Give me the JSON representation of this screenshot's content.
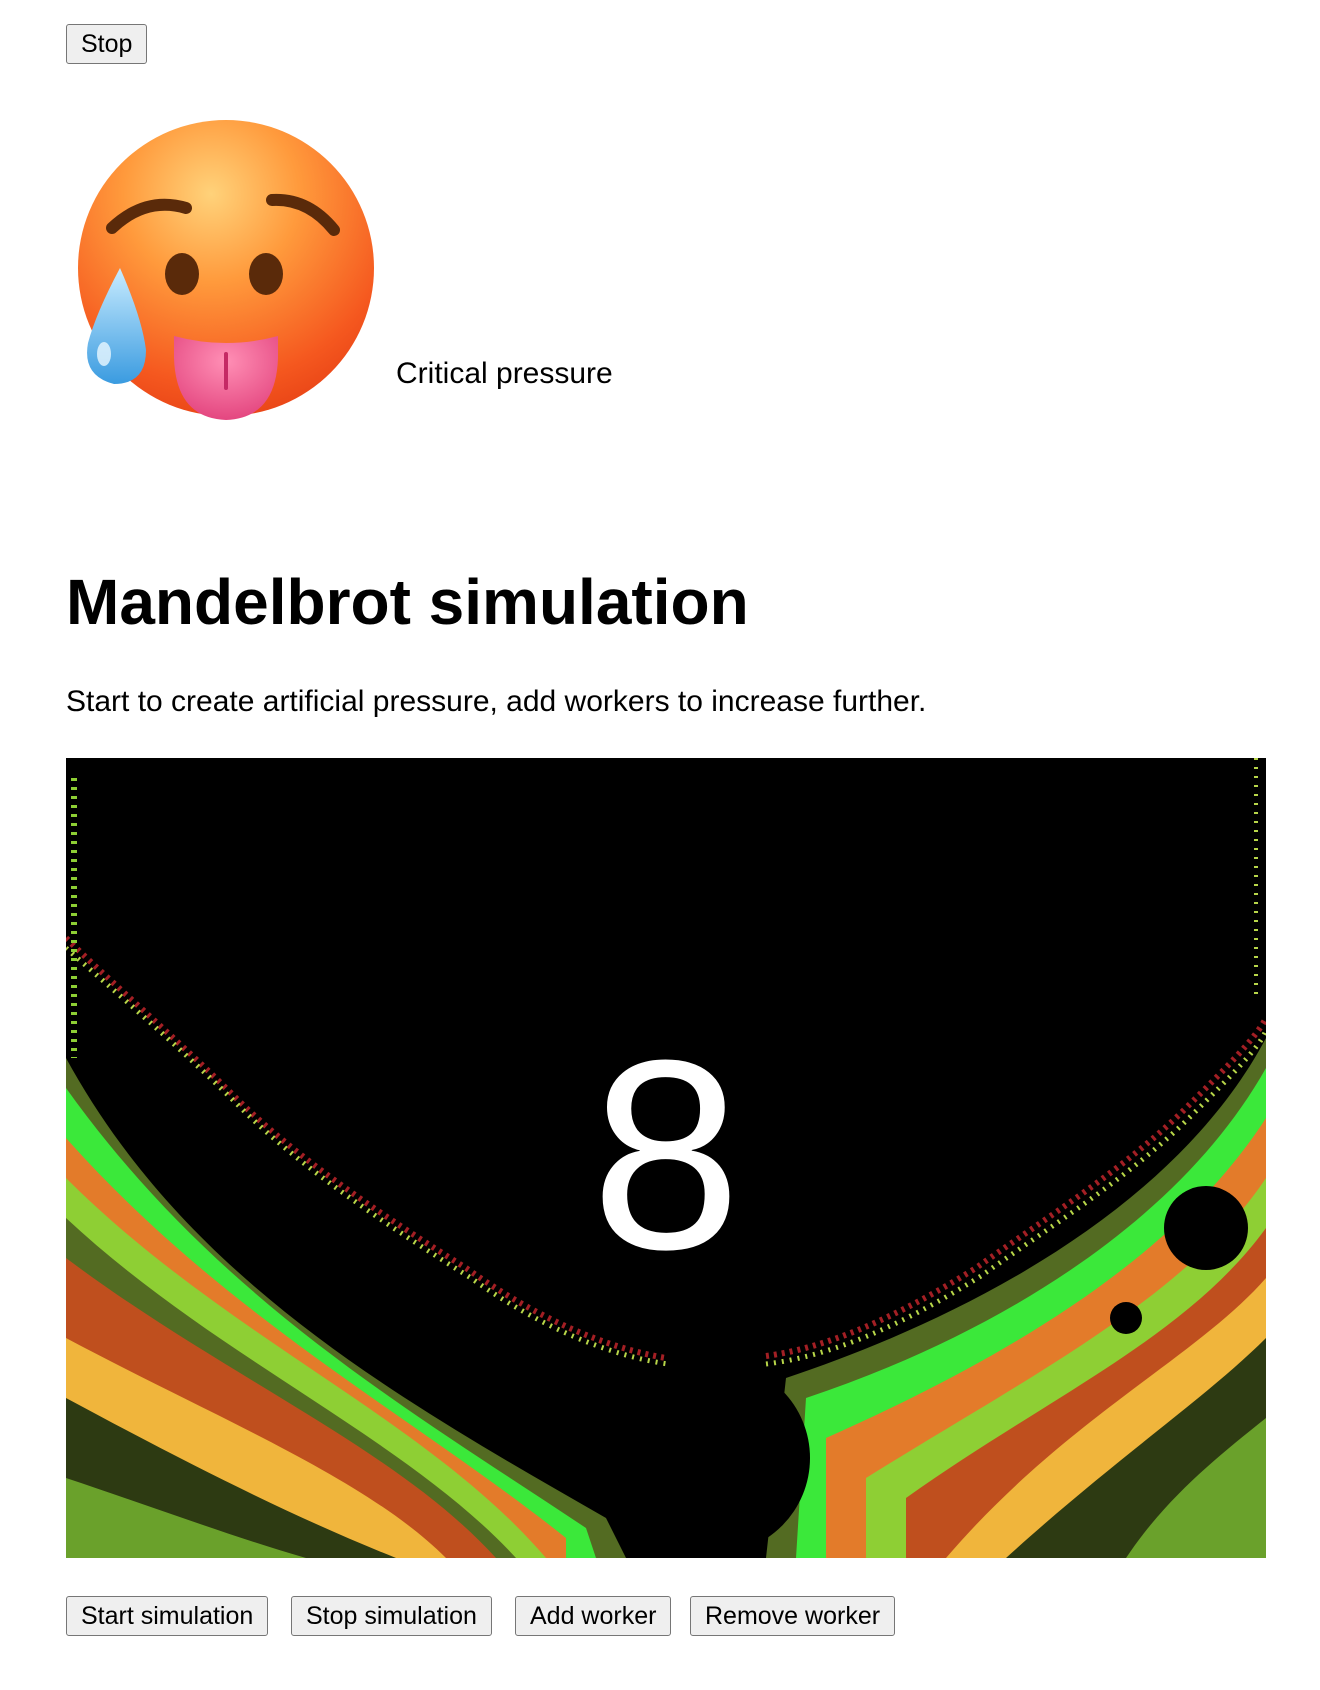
{
  "top_button": {
    "label": "Stop"
  },
  "status": {
    "emoji_icon": "hot-face-icon",
    "label": "Critical pressure"
  },
  "page": {
    "title": "Mandelbrot simulation",
    "description": "Start to create artificial pressure, add workers to increase further."
  },
  "canvas": {
    "counter": "8",
    "palette": [
      "#2d3a12",
      "#6aa12b",
      "#f0b53c",
      "#bf4f1e",
      "#8ecf34",
      "#536b22",
      "#3be83a",
      "#e37b2a",
      "#a31f24",
      "#b8d649"
    ]
  },
  "controls": {
    "start": "Start simulation",
    "stop": "Stop simulation",
    "add": "Add worker",
    "remove": "Remove worker"
  }
}
